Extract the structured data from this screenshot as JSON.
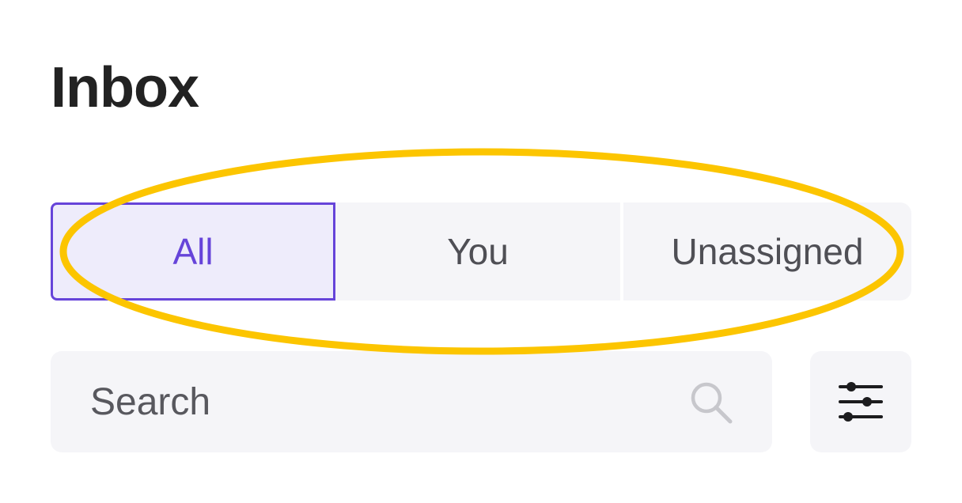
{
  "header": {
    "title": "Inbox"
  },
  "tabs": [
    {
      "label": "All",
      "selected": true
    },
    {
      "label": "You",
      "selected": false
    },
    {
      "label": "Unassigned",
      "selected": false
    }
  ],
  "search": {
    "placeholder": "Search",
    "value": ""
  },
  "icons": {
    "search": "search-icon",
    "filter": "sliders-icon"
  },
  "colors": {
    "accent": "#6644d9",
    "selected_tab_bg": "#eeecfb",
    "control_bg": "#f5f5f8",
    "highlight_ring": "#fcc500"
  }
}
